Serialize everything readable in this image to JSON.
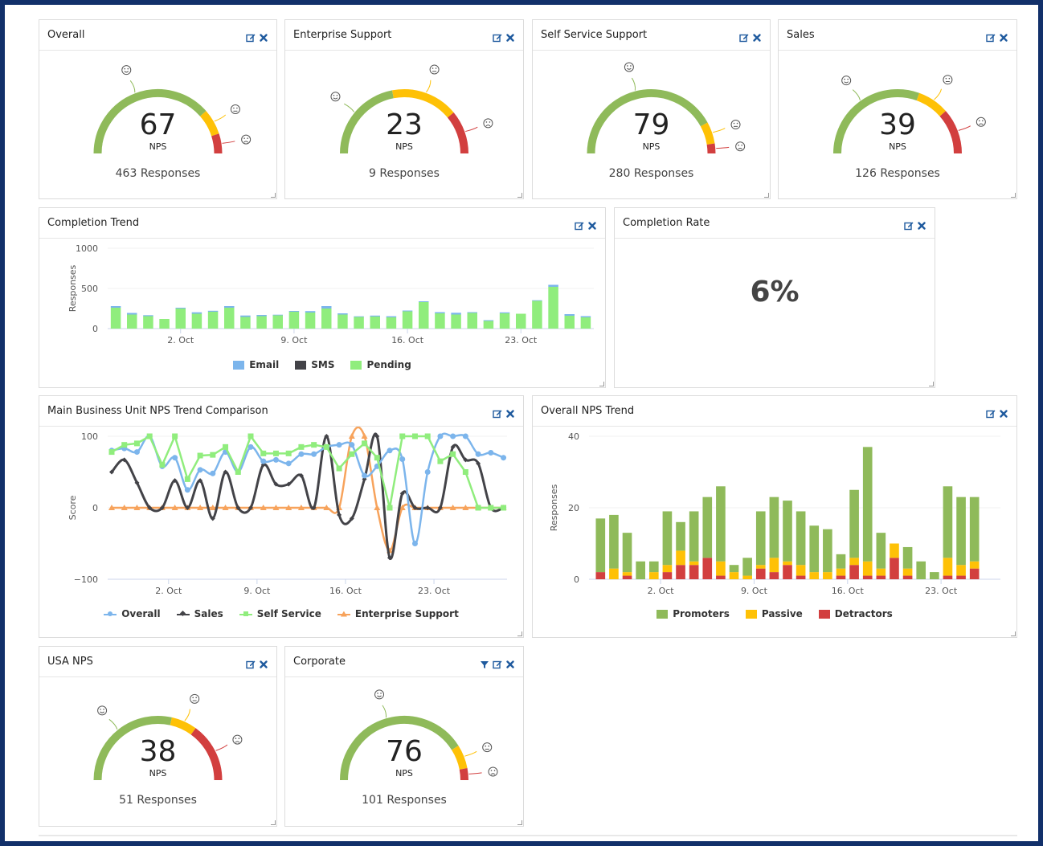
{
  "icons": {
    "edit": "edit-icon",
    "close": "close-icon",
    "filter": "filter-icon"
  },
  "colors": {
    "promoter": "#8fba5a",
    "passive": "#fec106",
    "detractor": "#d23f3f",
    "email": "#7cb5ec",
    "sms": "#434348",
    "pending": "#90ed7d",
    "tool_icon": "#1f5a9e",
    "frame": "#12306a"
  },
  "gauges": [
    {
      "id": "overall",
      "title": "Overall",
      "nps": "67",
      "nps_label": "NPS",
      "responses": "463 Responses",
      "promoters_pct": 0.77,
      "passive_pct": 0.13,
      "detractors_pct": 0.1,
      "filter": false
    },
    {
      "id": "enterprise",
      "title": "Enterprise Support",
      "nps": "23",
      "nps_label": "NPS",
      "responses": "9 Responses",
      "promoters_pct": 0.44,
      "passive_pct": 0.34,
      "detractors_pct": 0.22,
      "filter": false
    },
    {
      "id": "selfservice",
      "title": "Self Service Support",
      "nps": "79",
      "nps_label": "NPS",
      "responses": "280 Responses",
      "promoters_pct": 0.84,
      "passive_pct": 0.11,
      "detractors_pct": 0.05,
      "filter": false
    },
    {
      "id": "sales",
      "title": "Sales",
      "nps": "39",
      "nps_label": "NPS",
      "responses": "126 Responses",
      "promoters_pct": 0.61,
      "passive_pct": 0.16,
      "detractors_pct": 0.23,
      "filter": false
    },
    {
      "id": "usa",
      "title": "USA NPS",
      "nps": "38",
      "nps_label": "NPS",
      "responses": "51 Responses",
      "promoters_pct": 0.57,
      "passive_pct": 0.13,
      "detractors_pct": 0.3,
      "filter": false
    },
    {
      "id": "corporate",
      "title": "Corporate",
      "nps": "76",
      "nps_label": "NPS",
      "responses": "101 Responses",
      "promoters_pct": 0.82,
      "passive_pct": 0.12,
      "detractors_pct": 0.06,
      "filter": true
    }
  ],
  "completion_rate": {
    "title": "Completion Rate",
    "value": "6%"
  },
  "chart_data": [
    {
      "id": "completion-trend",
      "title": "Completion Trend",
      "type": "bar",
      "stacked": true,
      "ylabel": "Responses",
      "xlabel": "",
      "ylim": [
        0,
        1000
      ],
      "yticks": [
        0,
        500,
        1000
      ],
      "xtick_labels": [
        "2. Oct",
        "9. Oct",
        "16. Oct",
        "23. Oct"
      ],
      "xtick_index": [
        4,
        11,
        18,
        25
      ],
      "categories": [
        "28. Sep",
        "29. Sep",
        "30. Sep",
        "1. Oct",
        "2. Oct",
        "3. Oct",
        "4. Oct",
        "5. Oct",
        "6. Oct",
        "7. Oct",
        "8. Oct",
        "9. Oct",
        "10. Oct",
        "11. Oct",
        "12. Oct",
        "13. Oct",
        "14. Oct",
        "15. Oct",
        "16. Oct",
        "17. Oct",
        "18. Oct",
        "19. Oct",
        "20. Oct",
        "21. Oct",
        "22. Oct",
        "23. Oct",
        "24. Oct",
        "25. Oct",
        "26. Oct",
        "27. Oct"
      ],
      "series": [
        {
          "name": "Pending",
          "color": "#90ed7d",
          "values": [
            260,
            175,
            155,
            120,
            250,
            185,
            210,
            260,
            145,
            155,
            165,
            210,
            200,
            250,
            175,
            145,
            150,
            140,
            215,
            330,
            190,
            175,
            195,
            95,
            190,
            185,
            345,
            520,
            160,
            140
          ]
        },
        {
          "name": "Email",
          "color": "#7cb5ec",
          "values": [
            20,
            20,
            12,
            0,
            10,
            18,
            12,
            20,
            18,
            15,
            8,
            10,
            18,
            30,
            15,
            8,
            12,
            14,
            10,
            10,
            15,
            22,
            10,
            10,
            12,
            0,
            8,
            25,
            20,
            15
          ]
        },
        {
          "name": "SMS",
          "color": "#434348",
          "values": [
            0,
            0,
            0,
            0,
            0,
            0,
            0,
            0,
            0,
            0,
            0,
            0,
            0,
            0,
            0,
            0,
            0,
            0,
            0,
            0,
            0,
            0,
            0,
            0,
            0,
            0,
            0,
            0,
            0,
            0
          ]
        }
      ],
      "legend": [
        "Email",
        "SMS",
        "Pending"
      ],
      "legend_position": "bottom"
    },
    {
      "id": "nps-trend-comparison",
      "title": "Main Business Unit NPS Trend Comparison",
      "type": "line",
      "ylabel": "Score",
      "xlabel": "",
      "ylim": [
        -100,
        100
      ],
      "yticks": [
        -100,
        0,
        100
      ],
      "xtick_labels": [
        "2. Oct",
        "9. Oct",
        "16. Oct",
        "23. Oct"
      ],
      "xtick_index": [
        5,
        12,
        19,
        26
      ],
      "categories": [
        "27. Sep",
        "28. Sep",
        "29. Sep",
        "30. Sep",
        "1. Oct",
        "2. Oct",
        "3. Oct",
        "4. Oct",
        "5. Oct",
        "6. Oct",
        "7. Oct",
        "8. Oct",
        "9. Oct",
        "10. Oct",
        "11. Oct",
        "12. Oct",
        "13. Oct",
        "14. Oct",
        "15. Oct",
        "16. Oct",
        "17. Oct",
        "18. Oct",
        "19. Oct",
        "20. Oct",
        "21. Oct",
        "22. Oct",
        "23. Oct",
        "24. Oct",
        "25. Oct",
        "26. Oct",
        "27. Oct",
        "28. Oct"
      ],
      "series": [
        {
          "name": "Overall",
          "color": "#7cb5ec",
          "marker": "circle",
          "values": [
            80,
            83,
            78,
            100,
            58,
            70,
            25,
            53,
            48,
            78,
            50,
            85,
            65,
            67,
            62,
            75,
            75,
            85,
            88,
            88,
            45,
            58,
            80,
            68,
            -50,
            50,
            100,
            100,
            100,
            75,
            77,
            70
          ]
        },
        {
          "name": "Sales",
          "color": "#434348",
          "marker": "diamond",
          "values": [
            50,
            67,
            35,
            0,
            0,
            38,
            0,
            38,
            -15,
            50,
            0,
            0,
            60,
            33,
            33,
            45,
            0,
            100,
            -10,
            -15,
            40,
            100,
            -70,
            20,
            0,
            0,
            0,
            85,
            67,
            62,
            0,
            0
          ]
        },
        {
          "name": "Self Service",
          "color": "#90ed7d",
          "marker": "square",
          "values": [
            78,
            88,
            90,
            100,
            60,
            100,
            40,
            73,
            74,
            85,
            50,
            100,
            76,
            76,
            76,
            85,
            88,
            85,
            55,
            75,
            90,
            70,
            0,
            100,
            100,
            100,
            65,
            75,
            50,
            0,
            0,
            0
          ]
        },
        {
          "name": "Enterprise Support",
          "color": "#f7a35c",
          "marker": "triangle",
          "values": [
            0,
            0,
            0,
            0,
            0,
            0,
            0,
            0,
            0,
            0,
            0,
            0,
            0,
            0,
            0,
            0,
            0,
            0,
            0,
            100,
            100,
            0,
            -60,
            0,
            0,
            0,
            0,
            0,
            0,
            0,
            0,
            0
          ]
        }
      ],
      "legend": [
        "Overall",
        "Sales",
        "Self Service",
        "Enterprise Support"
      ],
      "legend_position": "bottom"
    },
    {
      "id": "overall-nps-trend",
      "title": "Overall NPS Trend",
      "type": "bar",
      "stacked": true,
      "ylabel": "Responses",
      "xlabel": "",
      "ylim": [
        0,
        40
      ],
      "yticks": [
        0,
        20,
        40
      ],
      "xtick_labels": [
        "2. Oct",
        "9. Oct",
        "16. Oct",
        "23. Oct"
      ],
      "xtick_index": [
        5,
        12,
        19,
        26
      ],
      "categories": [
        "27. Sep",
        "28. Sep",
        "29. Sep",
        "30. Sep",
        "1. Oct",
        "2. Oct",
        "3. Oct",
        "4. Oct",
        "5. Oct",
        "6. Oct",
        "7. Oct",
        "8. Oct",
        "9. Oct",
        "10. Oct",
        "11. Oct",
        "12. Oct",
        "13. Oct",
        "14. Oct",
        "15. Oct",
        "16. Oct",
        "17. Oct",
        "18. Oct",
        "19. Oct",
        "20. Oct",
        "21. Oct",
        "22. Oct",
        "23. Oct",
        "24. Oct",
        "25. Oct"
      ],
      "series": [
        {
          "name": "Detractors",
          "color": "#d23f3f",
          "values": [
            2,
            0,
            1,
            0,
            0,
            2,
            4,
            4,
            6,
            1,
            0,
            0,
            3,
            2,
            4,
            1,
            0,
            0,
            1,
            4,
            1,
            1,
            6,
            1,
            0,
            0,
            1,
            1,
            3
          ]
        },
        {
          "name": "Passive",
          "color": "#fec106",
          "values": [
            0,
            3,
            1,
            0,
            2,
            2,
            4,
            1,
            0,
            4,
            2,
            1,
            1,
            4,
            1,
            3,
            2,
            2,
            2,
            2,
            4,
            2,
            4,
            2,
            0,
            0,
            5,
            3,
            2
          ]
        },
        {
          "name": "Promoters",
          "color": "#8fba5a",
          "values": [
            15,
            15,
            11,
            5,
            3,
            15,
            8,
            14,
            17,
            21,
            2,
            5,
            15,
            17,
            17,
            15,
            13,
            12,
            4,
            19,
            32,
            10,
            0,
            6,
            5,
            2,
            20,
            19,
            18
          ]
        }
      ],
      "legend": [
        "Promoters",
        "Passive",
        "Detractors"
      ],
      "legend_position": "bottom"
    }
  ]
}
